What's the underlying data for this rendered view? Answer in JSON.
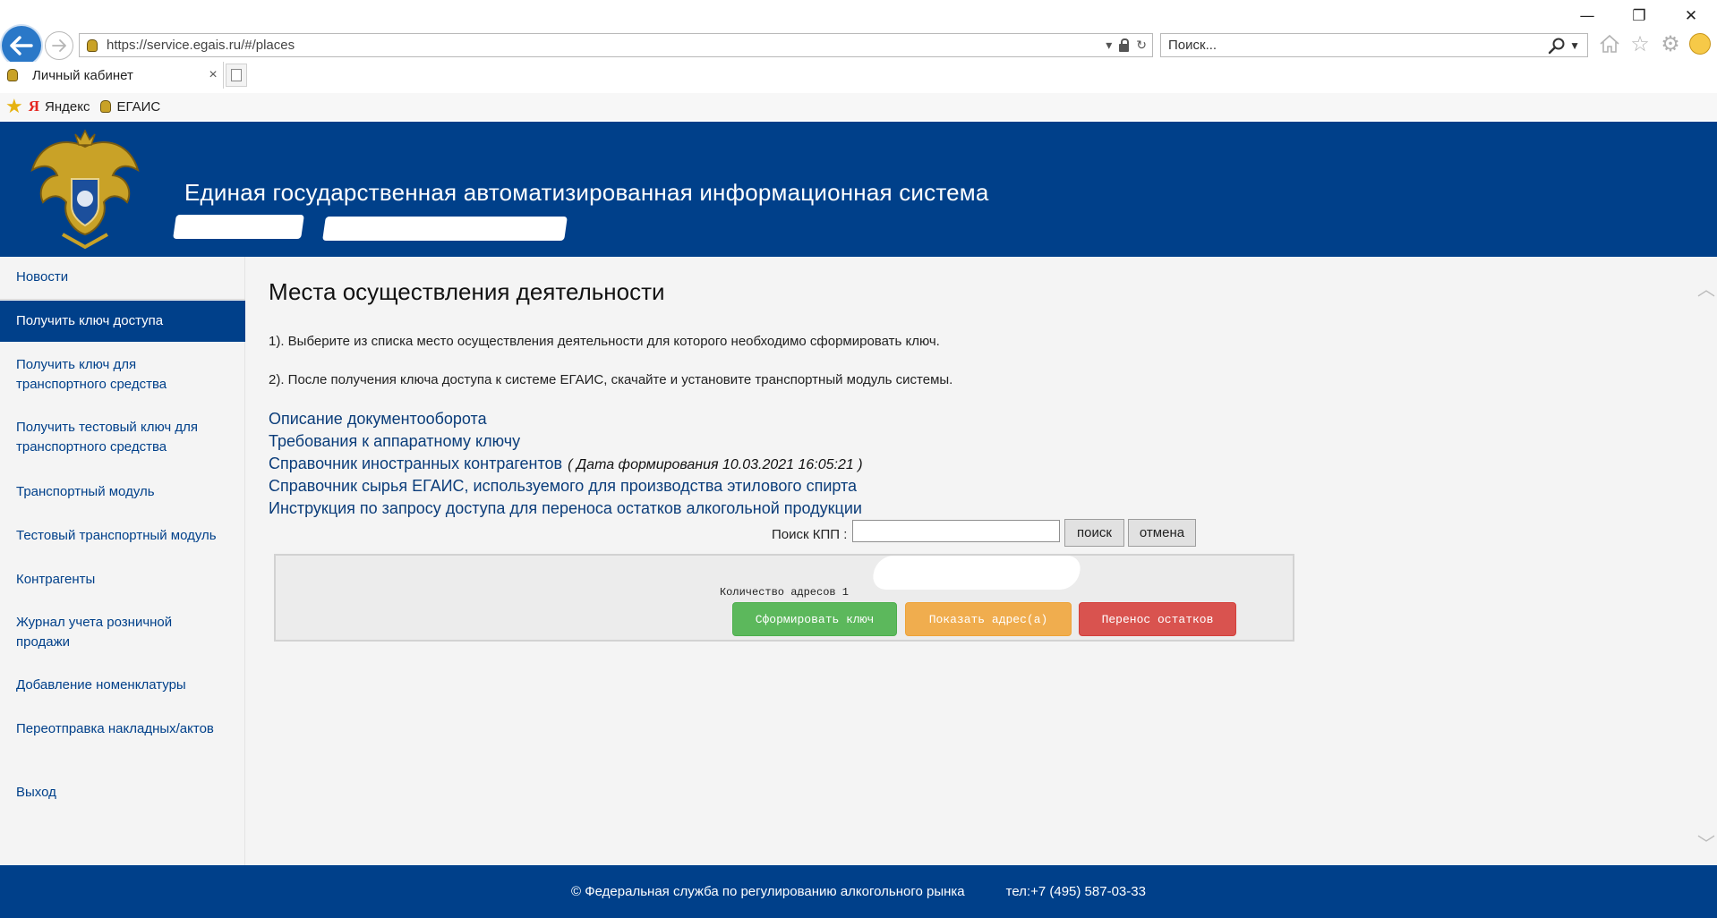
{
  "browser": {
    "url": "https://service.egais.ru/#/places",
    "search_placeholder": "Поиск...",
    "tab_title": "Личный кабинет",
    "tab_close": "×",
    "window_minimize": "—",
    "window_restore": "❐",
    "window_close": "✕",
    "favorites": [
      {
        "label": "Яндекс",
        "icon": "yandex-icon"
      },
      {
        "label": "ЕГАИС",
        "icon": "egais-icon"
      }
    ]
  },
  "header": {
    "title": "Единая государственная автоматизированная информационная система"
  },
  "sidebar": {
    "items": [
      {
        "label": "Новости",
        "active": false
      },
      {
        "label": "Получить ключ доступа",
        "active": true
      },
      {
        "label": "Получить ключ для транспортного средства",
        "active": false
      },
      {
        "label": "Получить тестовый ключ для транспортного средства",
        "active": false
      },
      {
        "label": "Транспортный модуль",
        "active": false
      },
      {
        "label": "Тестовый транспортный модуль",
        "active": false
      },
      {
        "label": "Контрагенты",
        "active": false
      },
      {
        "label": "Журнал учета розничной продажи",
        "active": false
      },
      {
        "label": "Добавление номенклатуры",
        "active": false
      },
      {
        "label": "Переотправка накладных/актов",
        "active": false
      },
      {
        "label": "Выход",
        "active": false
      }
    ]
  },
  "main": {
    "title": "Места осуществления деятельности",
    "step1": "1). Выберите из списка место осуществления деятельности для которого необходимо сформировать ключ.",
    "step2": "2). После получения ключа доступа к системе ЕГАИС, скачайте и установите транспортный модуль системы.",
    "links": [
      {
        "label": "Описание документооборота"
      },
      {
        "label": "Требования к аппаратному ключу"
      },
      {
        "label": "Справочник иностранных контрагентов",
        "note": "( Дата формирования 10.03.2021 16:05:21 )"
      },
      {
        "label": "Справочник сырья ЕГАИС, используемого для производства этилового спирта"
      },
      {
        "label": "Инструкция по запросу доступа для переноса остатков алкогольной продукции"
      }
    ],
    "kpp_label": "Поиск КПП :",
    "kpp_value": "",
    "search_button": "поиск",
    "cancel_button": "отмена",
    "address_count": "Количество адресов 1",
    "generate_key_button": "Сформировать ключ",
    "show_address_button": "Показать адрес(а)",
    "transfer_button": "Перенос остатков"
  },
  "footer": {
    "copyright": "© Федеральная служба по регулированию алкогольного рынка",
    "phone": "тел:+7 (495) 587-03-33"
  },
  "colors": {
    "brand_blue": "#00408a",
    "link_blue": "#0b3d7a",
    "green": "#5cb85c",
    "orange": "#f0ad4e",
    "red": "#d9534f"
  }
}
